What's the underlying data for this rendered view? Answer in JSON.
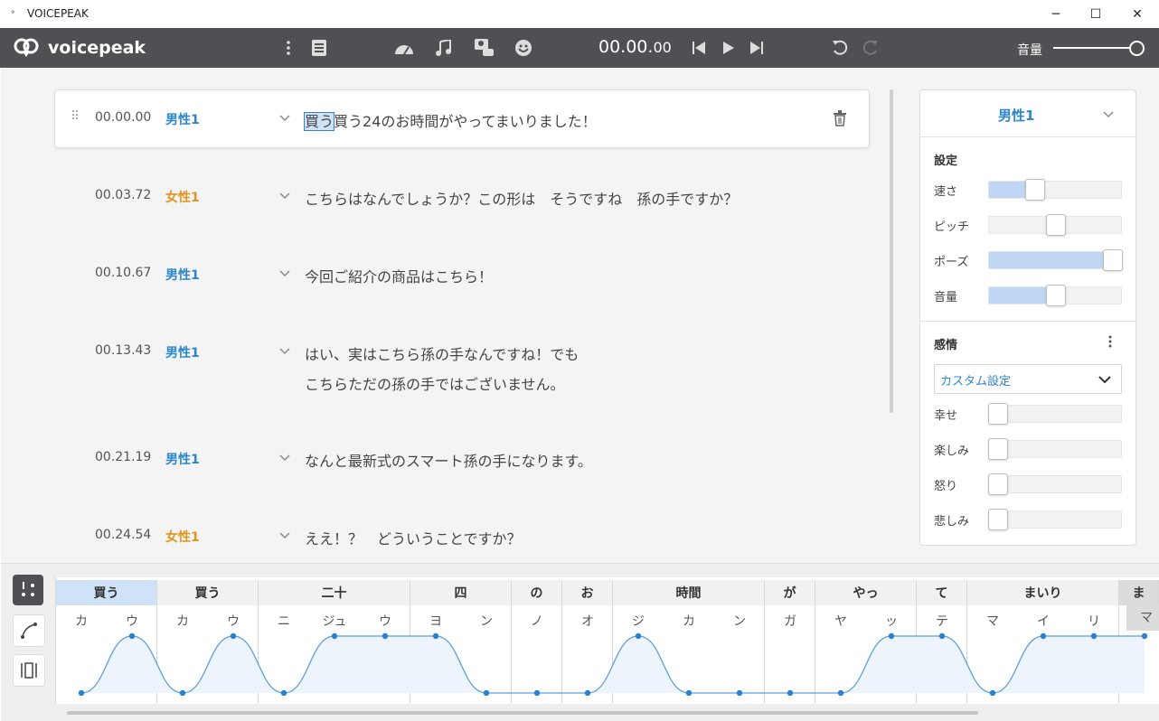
{
  "window": {
    "title": "VOICEPEAK",
    "icon": "voicepeak-small-icon",
    "minimize": "─",
    "maximize": "☐",
    "close": "✕"
  },
  "toolbar": {
    "brand": "voicepeak",
    "time_main": "00.00.",
    "time_frac": "00",
    "volume_label": "音量",
    "volume_level": 1.0,
    "icons": [
      "more-vert-icon",
      "dictionary-icon",
      "speed-gauge-icon",
      "music-note-icon",
      "speaker-user-icon",
      "emoji-icon",
      "skip-back-icon",
      "play-icon",
      "skip-forward-icon",
      "undo-icon",
      "redo-icon"
    ]
  },
  "rows": [
    {
      "time": "00.00.00",
      "speaker": "男性1",
      "gender": "male",
      "text_sel": "買う",
      "text": "買う24のお時間がやってまいりました！"
    },
    {
      "time": "00.03.72",
      "speaker": "女性1",
      "gender": "female",
      "text": "こちらはなんでしょうか？この形は　そうですね　孫の手ですか？"
    },
    {
      "time": "00.10.67",
      "speaker": "男性1",
      "gender": "male",
      "text": "今回ご紹介の商品はこちら！"
    },
    {
      "time": "00.13.43",
      "speaker": "男性1",
      "gender": "male",
      "text": "はい、実はこちら孫の手なんですね！でも",
      "text2": "こちらただの孫の手ではございません。"
    },
    {
      "time": "00.21.19",
      "speaker": "男性1",
      "gender": "male",
      "text": "なんと最新式のスマート孫の手になります。"
    },
    {
      "time": "00.24.54",
      "speaker": "女性1",
      "gender": "female",
      "text": "ええ！？　どういうことですか？"
    }
  ],
  "panel": {
    "speaker": "男性1",
    "settings_title": "設定",
    "settings": [
      {
        "label": "速さ",
        "value": 0.35
      },
      {
        "label": "ピッチ",
        "value": 0.5
      },
      {
        "label": "ポーズ",
        "value": 1.0
      },
      {
        "label": "音量",
        "value": 0.5
      }
    ],
    "emotion_title": "感情",
    "emotion_preset": "カスタム設定",
    "emotions": [
      {
        "label": "幸せ",
        "value": 0
      },
      {
        "label": "楽しみ",
        "value": 0
      },
      {
        "label": "怒り",
        "value": 0
      },
      {
        "label": "悲しみ",
        "value": 0
      }
    ]
  },
  "timeline": {
    "words": [
      "買う",
      "買う",
      "二十",
      "四",
      "の",
      "お",
      "時間",
      "が",
      "やっ",
      "て",
      "まいり",
      "ま"
    ],
    "moras": [
      "カ",
      "ウ",
      "カ",
      "ウ",
      "ニ",
      "ジュ",
      "ウ",
      "ヨ",
      "ン",
      "ノ",
      "オ",
      "ジ",
      "カ",
      "ン",
      "ガ",
      "ヤ",
      "ッ",
      "テ",
      "マ",
      "イ",
      "リ",
      "マ"
    ],
    "pitch_high": [
      0,
      1,
      0,
      1,
      0,
      1,
      1,
      1,
      0,
      0,
      0,
      1,
      0,
      0,
      0,
      0,
      1,
      1,
      0,
      1,
      1,
      1
    ]
  }
}
